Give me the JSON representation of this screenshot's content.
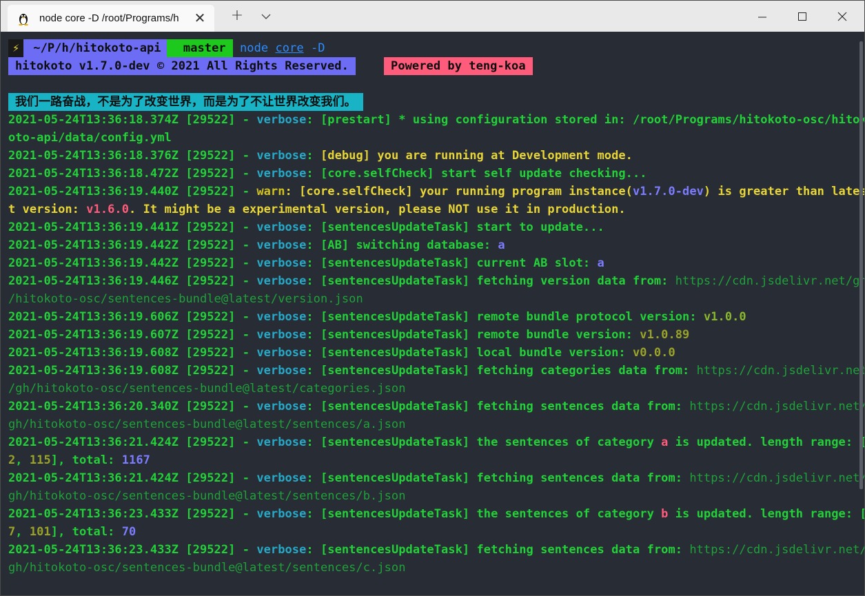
{
  "tab": {
    "title": "node core -D /root/Programs/h",
    "close_label": "✕"
  },
  "titlebar": {
    "new_tab_label": "+"
  },
  "prompt": {
    "bolt": "⚡",
    "path": "~/P/h/hitokoto-api",
    "git_branch": " master",
    "cmd_node": "node",
    "cmd_core": "core",
    "cmd_flag": "-D"
  },
  "banner": {
    "left": "hitokoto v1.7.0-dev © 2021 All Rights Reserved.",
    "right": "Powered by teng-koa"
  },
  "motto": "我们一路奋战，不是为了改变世界，而是为了不让世界改变我们。",
  "log": {
    "ts1": "2021-05-24T13:36:18.374Z [29522] - ",
    "l1a": "[prestart] * using configuration stored in: /root/Programs/hitokoto-osc/hitok",
    "l1b": "oto-api/data/config.yml",
    "ts2": "2021-05-24T13:36:18.376Z [29522] - ",
    "l2": "[debug] you are running at Development mode.",
    "ts3": "2021-05-24T13:36:18.472Z [29522] - ",
    "l3": "[core.selfCheck] start self update checking...",
    "ts4": "2021-05-24T13:36:19.440Z [29522] - ",
    "l4a": "[core.selfCheck] your running program instance(",
    "l4b": "v1.7.0-dev",
    "l4c": ") is greater than lates",
    "l4d": "t version: ",
    "l4e": "v1.6.0",
    "l4f": ". It might be a experimental version, please NOT use it in production.",
    "ts5": "2021-05-24T13:36:19.441Z [29522] - ",
    "l5": "[sentencesUpdateTask] start to update...",
    "ts6": "2021-05-24T13:36:19.442Z [29522] - ",
    "l6": "[AB] switching database: ",
    "l6v": "a",
    "ts7": "2021-05-24T13:36:19.442Z [29522] - ",
    "l7": "[sentencesUpdateTask] current AB slot: ",
    "l7v": "a",
    "ts8": "2021-05-24T13:36:19.446Z [29522] - ",
    "l8": "[sentencesUpdateTask] fetching version data from: ",
    "l8u1": "https://cdn.jsdelivr.net/gh",
    "l8u2": "/hitokoto-osc/sentences-bundle@latest/version.json",
    "ts9": "2021-05-24T13:36:19.606Z [29522] - ",
    "l9": "[sentencesUpdateTask] remote bundle protocol version: ",
    "l9v": "v1.0.0",
    "ts10": "2021-05-24T13:36:19.607Z [29522] - ",
    "l10": "[sentencesUpdateTask] remote bundle version: ",
    "l10v": "v1.0.89",
    "ts11": "2021-05-24T13:36:19.608Z [29522] - ",
    "l11": "[sentencesUpdateTask] local bundle version: ",
    "l11v": "v0.0.0",
    "ts12": "2021-05-24T13:36:19.608Z [29522] - ",
    "l12": "[sentencesUpdateTask] fetching categories data from: ",
    "l12u1": "https://cdn.jsdelivr.net",
    "l12u2": "/gh/hitokoto-osc/sentences-bundle@latest/categories.json",
    "ts13": "2021-05-24T13:36:20.340Z [29522] - ",
    "l13": "[sentencesUpdateTask] fetching sentences data from: ",
    "l13u1": "https://cdn.jsdelivr.net/",
    "l13u2": "gh/hitokoto-osc/sentences-bundle@latest/sentences/a.json",
    "ts14": "2021-05-24T13:36:21.424Z [29522] - ",
    "l14a": "[sentencesUpdateTask] the sentences of category ",
    "l14cat": "a",
    "l14b": " is updated. length range: [",
    "l14min": "2",
    "l14sep": ", ",
    "l14max": "115",
    "l14c": "], total: ",
    "l14tot": "1167",
    "ts15": "2021-05-24T13:36:21.424Z [29522] - ",
    "l15": "[sentencesUpdateTask] fetching sentences data from: ",
    "l15u1": "https://cdn.jsdelivr.net/",
    "l15u2": "gh/hitokoto-osc/sentences-bundle@latest/sentences/b.json",
    "ts16": "2021-05-24T13:36:23.433Z [29522] - ",
    "l16a": "[sentencesUpdateTask] the sentences of category ",
    "l16cat": "b",
    "l16b": " is updated. length range: [",
    "l16min": "7",
    "l16sep": ", ",
    "l16max": "101",
    "l16c": "], total: ",
    "l16tot": "70",
    "ts17": "2021-05-24T13:36:23.433Z [29522] - ",
    "l17": "[sentencesUpdateTask] fetching sentences data from: ",
    "l17u1": "https://cdn.jsdelivr.net/",
    "l17u2": "gh/hitokoto-osc/sentences-bundle@latest/sentences/c.json",
    "verbose": "verbose",
    "warn": "warn",
    "colon": ": "
  },
  "colors": {
    "terminal_bg": "#282c34",
    "log_green": "#23d139",
    "verbose_cyan": "#27a9c8",
    "warn_yellow": "#e8d536"
  }
}
